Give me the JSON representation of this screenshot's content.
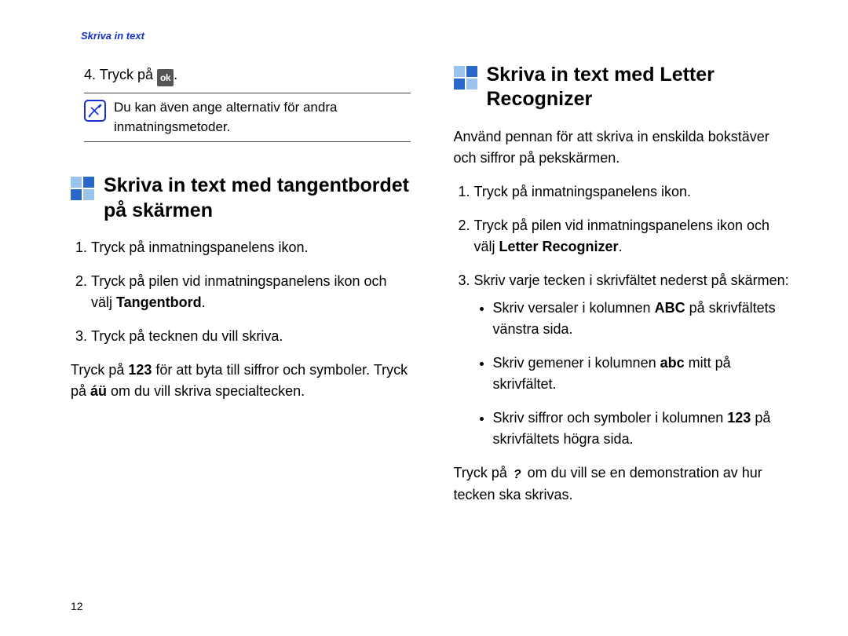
{
  "header": "Skriva in text",
  "page_number": "12",
  "left": {
    "step4_prefix": "4. Tryck på ",
    "ok_label": "ok",
    "step4_suffix": ".",
    "note": "Du kan även ange alternativ för andra inmatningsmetoder.",
    "section_title": "Skriva in text med tangentbordet på skärmen",
    "ol": [
      "Tryck på inmatningspanelens ikon.",
      [
        "Tryck på pilen vid inmatningspanelens ikon och välj ",
        "Tangentbord",
        "."
      ],
      "Tryck på tecknen du vill skriva."
    ],
    "after": [
      "Tryck på ",
      "123",
      " för att byta till siffror och symboler. Tryck på ",
      "áü",
      " om du vill skriva specialtecken."
    ]
  },
  "right": {
    "section_title": "Skriva in text med Letter Recognizer",
    "intro": "Använd pennan för att skriva in enskilda bokstäver och siffror på pekskärmen.",
    "ol1": "Tryck på inmatningspanelens ikon.",
    "ol2": [
      "Tryck på pilen vid inmatningspanelens ikon och välj ",
      "Letter Recognizer",
      "."
    ],
    "ol3_lead": "Skriv varje tecken i skrivfältet nederst på skärmen:",
    "bullets": [
      [
        "Skriv versaler i kolumnen ",
        "ABC",
        " på skrivfältets vänstra sida."
      ],
      [
        "Skriv gemener i kolumnen ",
        "abc",
        " mitt på skrivfältet."
      ],
      [
        "Skriv siffror och symboler i kolumnen ",
        "123",
        " på skrivfältets högra sida."
      ]
    ],
    "after_prefix": "Tryck på ",
    "qmark": "?",
    "after_suffix": " om du vill se en demonstration av hur tecken ska skrivas."
  }
}
